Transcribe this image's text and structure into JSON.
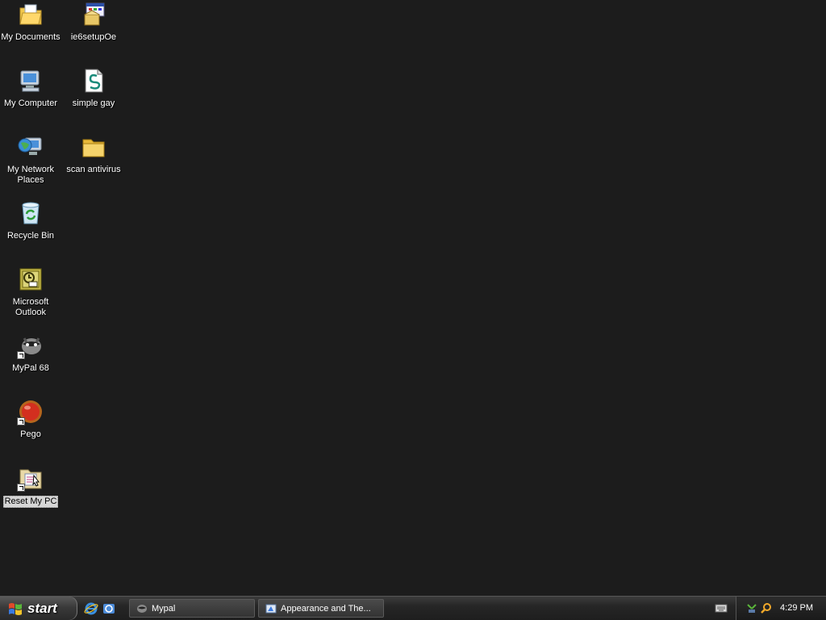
{
  "desktop": {
    "icons": [
      {
        "label": "My Documents",
        "icon": "my-documents-icon"
      },
      {
        "label": "My Computer",
        "icon": "my-computer-icon"
      },
      {
        "label": "My Network Places",
        "icon": "network-places-icon"
      },
      {
        "label": "Recycle Bin",
        "icon": "recycle-bin-icon"
      },
      {
        "label": "Microsoft Outlook",
        "icon": "outlook-icon"
      },
      {
        "label": "MyPal 68",
        "icon": "mypal-icon"
      },
      {
        "label": "Pego",
        "icon": "pego-icon"
      },
      {
        "label": "Reset My PC",
        "icon": "reset-my-pc-icon"
      },
      {
        "label": "ie6setupOe",
        "icon": "installer-icon"
      },
      {
        "label": "simple gay",
        "icon": "script-file-icon"
      },
      {
        "label": "scan antivirus",
        "icon": "folder-icon"
      }
    ],
    "selected": "Reset My PC"
  },
  "taskbar": {
    "start_label": "start",
    "quick_launch": [
      "internet-explorer-icon",
      "outlook-express-icon"
    ],
    "tasks": [
      {
        "label": "Mypal",
        "icon": "mypal-icon"
      },
      {
        "label": "Appearance and The...",
        "icon": "control-panel-icon"
      }
    ],
    "tray_icons": [
      "keyboard-icon",
      "network-icon",
      "search-icon"
    ],
    "clock": "4:29 PM"
  },
  "colors": {
    "desktop_bg": "#1c1c1c",
    "label_text": "#ffffff",
    "selected_label_bg": "#d6d6d6"
  }
}
